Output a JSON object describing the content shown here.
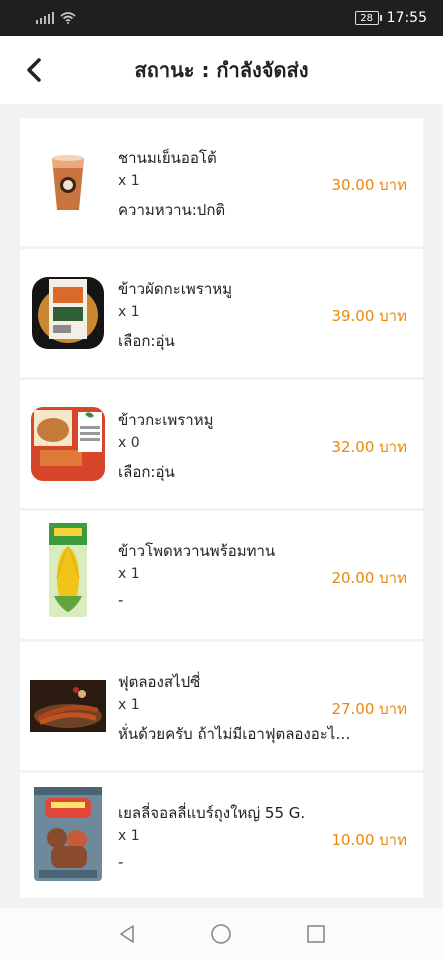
{
  "status_bar": {
    "battery": "28",
    "time": "17:55"
  },
  "header": {
    "title": "สถานะ : กำลังจัดส่ง"
  },
  "items": [
    {
      "name": "ชานมเย็นออโต้",
      "qty": "x 1",
      "note": "ความหวาน:ปกติ",
      "price": "30.00 บาท",
      "image": "iced-milk-tea"
    },
    {
      "name": "ข้าวผัดกะเพราหมู",
      "qty": "x 1",
      "note": "เลือก:อุ่น",
      "price": "39.00 บาท",
      "image": "fried-rice-tray"
    },
    {
      "name": "ข้าวกะเพราหมู",
      "qty": "x 0",
      "note": "เลือก:อุ่น",
      "price": "32.00 บาท",
      "image": "rice-box-orange"
    },
    {
      "name": "ข้าวโพดหวานพร้อมทาน",
      "qty": "x 1",
      "note": "-",
      "price": "20.00 บาท",
      "image": "sweet-corn-pack"
    },
    {
      "name": "ฟุตลองสไปซี่",
      "qty": "x 1",
      "note": "หั่นด้วยครับ ถ้าไม่มีเอาฟุตลองอะไรก็ได้",
      "price": "27.00 บาท",
      "image": "sausage-plate"
    },
    {
      "name": "เยลลี่จอลลี่แบร์ถุงใหญ่ 55 G.",
      "qty": "x 1",
      "note": "-",
      "price": "10.00 บาท",
      "image": "jelly-bear-bag"
    }
  ],
  "colors": {
    "price": "#e8890c",
    "status_bar": "#1f1f1f"
  }
}
